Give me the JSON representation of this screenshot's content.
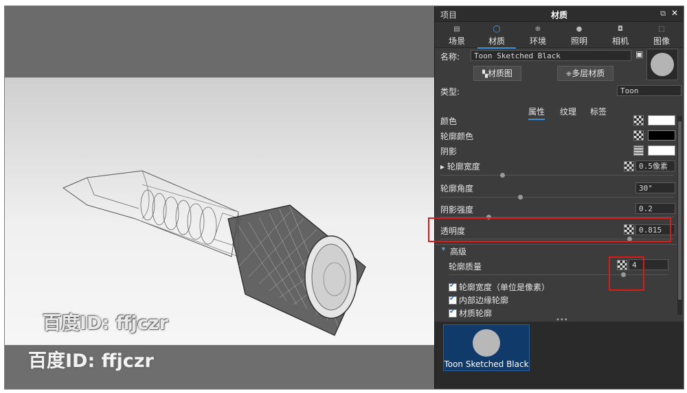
{
  "panel": {
    "header_left": "项目",
    "title": "材质",
    "tabs": [
      {
        "label": "场景",
        "icon": "scene-icon"
      },
      {
        "label": "材质",
        "icon": "material-icon"
      },
      {
        "label": "环境",
        "icon": "environment-icon"
      },
      {
        "label": "照明",
        "icon": "lighting-icon"
      },
      {
        "label": "相机",
        "icon": "camera-icon"
      },
      {
        "label": "图像",
        "icon": "image-icon"
      }
    ],
    "active_tab": "材质"
  },
  "material": {
    "name_label": "名称:",
    "name_value": "Toon Sketched Black",
    "graph_button": "材质图",
    "multilayer_button": "多层材质",
    "type_label": "类型:",
    "type_value": "Toon",
    "subtabs": [
      "属性",
      "纹理",
      "标签"
    ],
    "active_subtab": "属性"
  },
  "properties": {
    "color_label": "颜色",
    "outline_color_label": "轮廓颜色",
    "shadow_label": "阴影",
    "outline_width_label": "轮廓宽度",
    "outline_width_value": "0.5像素",
    "outline_angle_label": "轮廓角度",
    "outline_angle_value": "30°",
    "shadow_strength_label": "阴影强度",
    "shadow_strength_value": "0.2",
    "transparency_label": "透明度",
    "transparency_value": "0.815",
    "advanced_label": "高级",
    "outline_quality_label": "轮廓质量",
    "outline_quality_value": "4",
    "check_pixel_units": "轮廓宽度（单位是像素）",
    "check_inner_edges": "内部边缘轮廓",
    "check_material_outline": "材质轮廓"
  },
  "library": {
    "item_label": "Toon Sketched Black"
  },
  "watermarks": [
    "百度ID: ffjczr",
    "百度ID: ffjczr"
  ],
  "colors": {
    "accent": "#3d8fd9",
    "highlight": "#e01818",
    "panel_bg": "#3c3c3c",
    "library_selected": "#0f3a6a"
  }
}
